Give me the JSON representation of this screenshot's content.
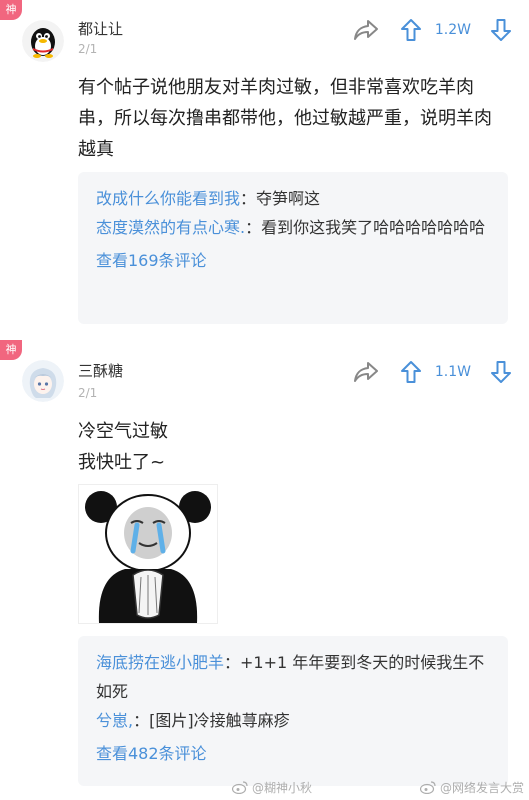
{
  "posts": [
    {
      "badge": "神",
      "username": "都让让",
      "date": "2/1",
      "vote_count": "1.2W",
      "content": "有个帖子说他朋友对羊肉过敏，但非常喜欢吃羊肉串，所以每次撸串都带他，他过敏越严重，说明羊肉越真",
      "replies": [
        {
          "author": "改成什么你能看到我",
          "text": "：夺笋啊这"
        },
        {
          "author": "态度漠然的有点心寒.",
          "text": "：看到你这我笑了哈哈哈哈哈哈哈"
        }
      ],
      "view_more": "查看169条评论"
    },
    {
      "badge": "神",
      "username": "三酥糖",
      "date": "2/1",
      "vote_count": "1.1W",
      "content_lines": [
        "冷空气过敏",
        "我快吐了~"
      ],
      "replies": [
        {
          "author": "海底捞在逃小肥羊",
          "text": "：+1+1 年年要到冬天的时候我生不如死"
        },
        {
          "author": "兮崽,",
          "text": "：[图片]冷接触荨麻疹"
        }
      ],
      "view_more": "查看482条评论"
    }
  ],
  "watermarks": [
    "@糊神小秋",
    "@网络发言大赏"
  ],
  "icons": {
    "share": "share-arrow-icon",
    "upvote": "arrow-up-icon",
    "downvote": "arrow-down-icon"
  },
  "colors": {
    "accent": "#4a90d9",
    "badge": "#f1667f",
    "reply_bg": "#f5f6f8"
  }
}
